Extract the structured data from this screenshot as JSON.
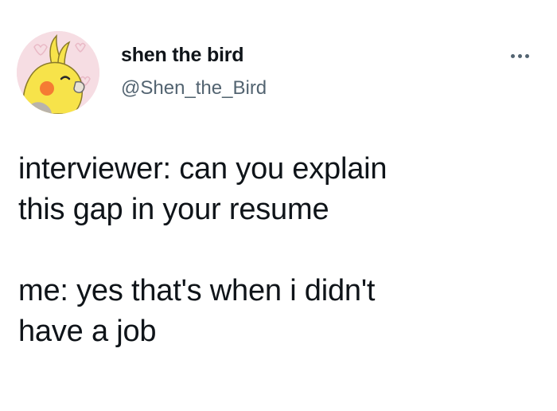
{
  "author": {
    "display_name": "shen the bird",
    "handle": "@Shen_the_Bird"
  },
  "tweet": {
    "lines": [
      "interviewer: can you explain",
      "this gap in your resume",
      "",
      "me: yes that's when i didn't",
      "have a job"
    ]
  },
  "icons": {
    "avatar": "cockatiel-avatar",
    "more": "more-options-icon"
  },
  "colors": {
    "text": "#0f1419",
    "secondary": "#536471",
    "avatar_bg": "#f6dde3",
    "bird_yellow": "#f7e34a",
    "cheek_orange": "#f57b33"
  }
}
